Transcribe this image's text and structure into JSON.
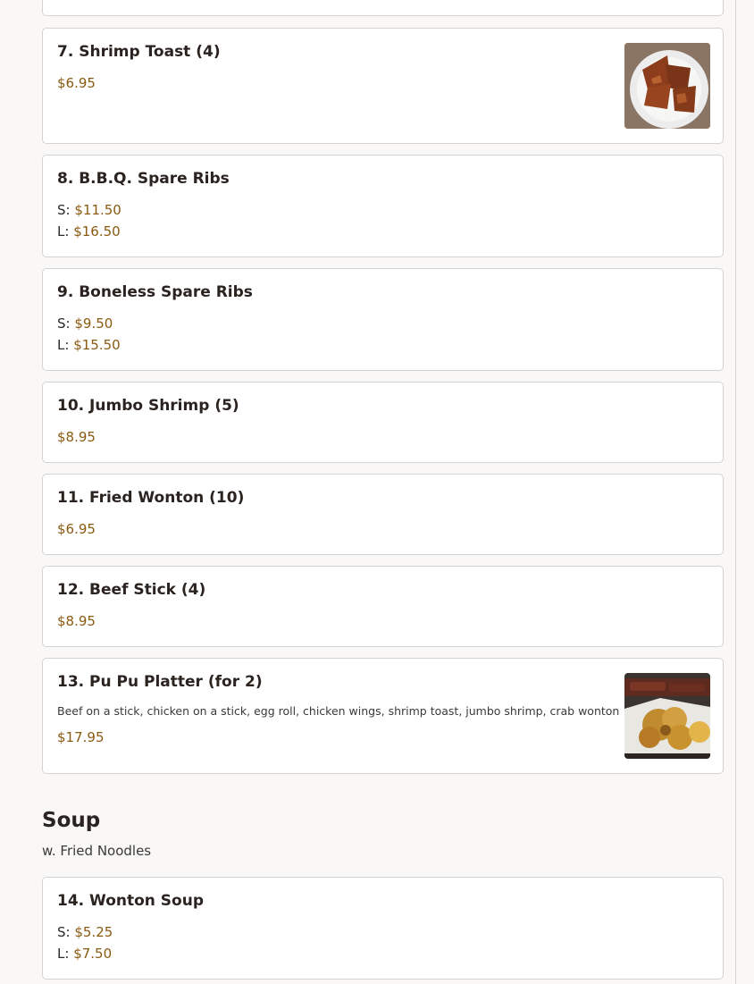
{
  "items": [
    {
      "number": "7.",
      "name": "Shrimp Toast (4)",
      "price": "$6.95"
    },
    {
      "number": "8.",
      "name": "B.B.Q. Spare Ribs",
      "small_label": "S:",
      "small_price": "$11.50",
      "large_label": "L:",
      "large_price": "$16.50"
    },
    {
      "number": "9.",
      "name": "Boneless Spare Ribs",
      "small_label": "S:",
      "small_price": "$9.50",
      "large_label": "L:",
      "large_price": "$15.50"
    },
    {
      "number": "10.",
      "name": "Jumbo Shrimp (5)",
      "price": "$8.95"
    },
    {
      "number": "11.",
      "name": "Fried Wonton (10)",
      "price": "$6.95"
    },
    {
      "number": "12.",
      "name": "Beef Stick (4)",
      "price": "$8.95"
    },
    {
      "number": "13.",
      "name": "Pu Pu Platter (for 2)",
      "description": "Beef on a stick, chicken on a stick, egg roll, chicken wings, shrimp toast, jumbo shrimp, crab wonton",
      "price": "$17.95"
    },
    {
      "number": "14.",
      "name": "Wonton Soup",
      "small_label": "S:",
      "small_price": "$5.25",
      "large_label": "L:",
      "large_price": "$7.50"
    }
  ],
  "soup_section": {
    "title": "Soup",
    "subtitle": "w. Fried Noodles"
  },
  "colors": {
    "price": "#8a5a12",
    "card_border": "#d3d3d3",
    "page_background": "#f9f8f6"
  }
}
